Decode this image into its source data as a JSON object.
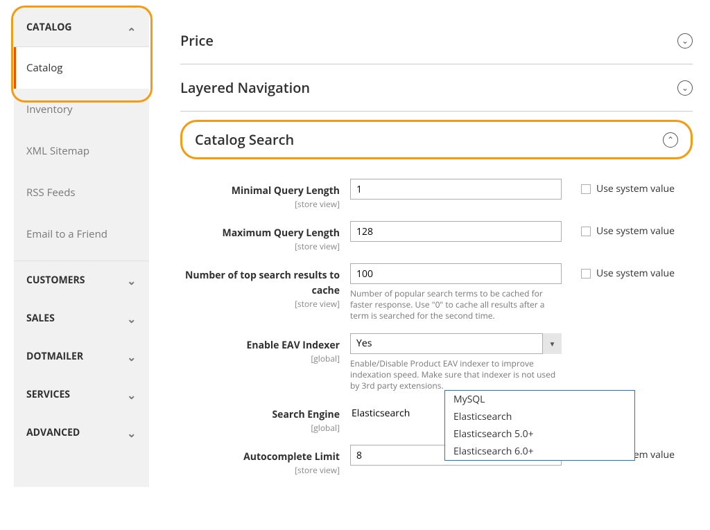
{
  "sidebar": {
    "catalog_header": "CATALOG",
    "items": [
      "Catalog",
      "Inventory",
      "XML Sitemap",
      "RSS Feeds",
      "Email to a Friend"
    ],
    "customers": "CUSTOMERS",
    "sales": "SALES",
    "dotmailer": "DOTMAILER",
    "services": "SERVICES",
    "advanced": "ADVANCED"
  },
  "sections": {
    "price": "Price",
    "layered_nav": "Layered Navigation",
    "catalog_search": "Catalog Search"
  },
  "fields": {
    "min_q": {
      "label": "Minimal Query Length",
      "scope": "[store view]",
      "value": "1"
    },
    "max_q": {
      "label": "Maximum Query Length",
      "scope": "[store view]",
      "value": "128"
    },
    "top_cache": {
      "label": "Number of top search results to cache",
      "scope": "[store view]",
      "value": "100",
      "hint": "Number of popular search terms to be cached for faster response. Use \"0\" to cache all results after a term is searched for the second time."
    },
    "eav": {
      "label": "Enable EAV Indexer",
      "scope": "[global]",
      "value": "Yes",
      "hint": "Enable/Disable Product EAV indexer to improve indexation speed. Make sure that indexer is not used by 3rd party extensions."
    },
    "engine": {
      "label": "Search Engine",
      "scope": "[global]",
      "value": "Elasticsearch"
    },
    "autocomplete": {
      "label": "Autocomplete Limit",
      "scope": "[store view]",
      "value": "8"
    }
  },
  "use_system": "Use system value",
  "engine_options": [
    "MySQL",
    "Elasticsearch",
    "Elasticsearch 5.0+",
    "Elasticsearch 6.0+"
  ]
}
